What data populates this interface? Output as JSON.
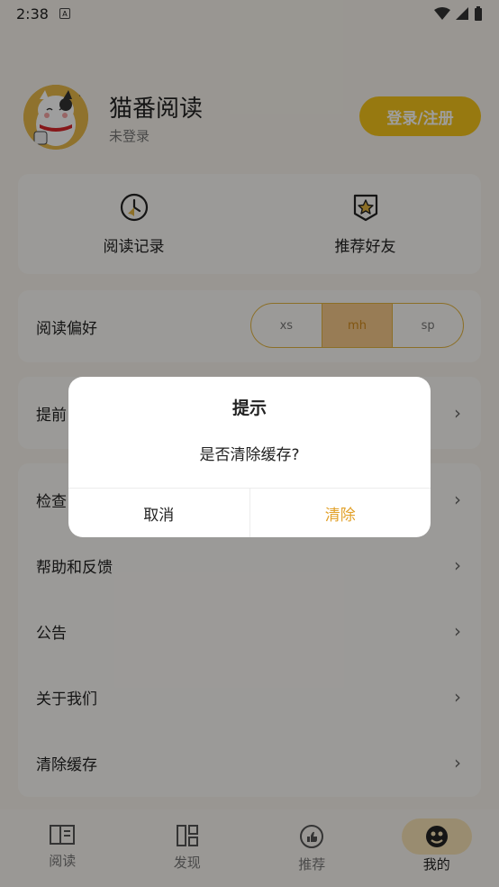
{
  "status": {
    "time": "2:38",
    "a_icon": "A"
  },
  "header": {
    "app_name": "猫番阅读",
    "login_state": "未登录",
    "login_button": "登录/注册"
  },
  "quick": {
    "history": "阅读记录",
    "recommend_friend": "推荐好友"
  },
  "preference": {
    "label": "阅读偏好",
    "options": [
      "xs",
      "mh",
      "sp"
    ],
    "selected": "mh"
  },
  "rows": {
    "advance": "提前",
    "check": "检查",
    "help": "帮助和反馈",
    "notice": "公告",
    "about": "关于我们",
    "clear": "清除缓存"
  },
  "tabs": {
    "read": "阅读",
    "discover": "发现",
    "recommend": "推荐",
    "mine": "我的"
  },
  "dialog": {
    "title": "提示",
    "message": "是否清除缓存?",
    "cancel": "取消",
    "confirm": "清除"
  },
  "colors": {
    "accent": "#f4c31a",
    "confirm": "#e2a12a"
  }
}
